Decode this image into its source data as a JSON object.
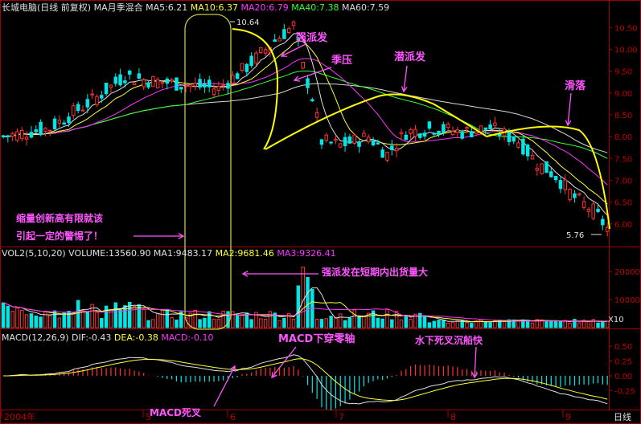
{
  "chart_data": {
    "type": "candlestick",
    "period": "日线",
    "price_panel": {
      "header": [
        {
          "text": "长城电脑(日线 前复权) MA月季混合",
          "color": "#e0e0e0"
        },
        {
          "text": "MA5:6.21",
          "color": "#e0e0e0"
        },
        {
          "text": "MA10:6.37",
          "color": "#ffff33"
        },
        {
          "text": "MA20:6.79",
          "color": "#ff33ff"
        },
        {
          "text": "MA40:7.38",
          "color": "#33ff33"
        },
        {
          "text": "MA60:7.59",
          "color": "#d8d8d8"
        }
      ],
      "y_ticks": [
        "10.50",
        "10.00",
        "9.50",
        "9.00",
        "8.50",
        "8.00",
        "7.50",
        "7.00",
        "6.50",
        "6.00"
      ],
      "ylim": [
        5.5,
        10.8
      ],
      "high_label": "10.64",
      "low_label": "5.76",
      "ma_series": [
        {
          "name": "MA5",
          "color": "#e0e0e0"
        },
        {
          "name": "MA10",
          "color": "#ffff33"
        },
        {
          "name": "MA20",
          "color": "#ff33ff"
        },
        {
          "name": "MA40",
          "color": "#33ff33"
        },
        {
          "name": "MA60",
          "color": "#d8d8d8"
        }
      ]
    },
    "volume_panel": {
      "header": [
        {
          "text": "VOL2(5,10,20) VOLUME:13560.90",
          "color": "#e0e0e0"
        },
        {
          "text": "MA1:9483.17",
          "color": "#e0e0e0"
        },
        {
          "text": "MA2:9681.46",
          "color": "#ffff33"
        },
        {
          "text": "MA3:9326.41",
          "color": "#ff33ff"
        }
      ],
      "y_ticks": [
        "20000",
        "10000"
      ],
      "unit_box": "X10"
    },
    "macd_panel": {
      "header": [
        {
          "text": "MACD(12,26,9)",
          "color": "#e0e0e0"
        },
        {
          "text": "DIF:-0.43",
          "color": "#e0e0e0"
        },
        {
          "text": "DEA:-0.38",
          "color": "#ffff33"
        },
        {
          "text": "MACD:-0.10",
          "color": "#ff33ff"
        }
      ],
      "y_ticks": [
        "0.50",
        "0.25",
        "0.00",
        "-0.25"
      ]
    },
    "x_labels": [
      "2004年",
      "5",
      "6",
      "7",
      "8",
      "9"
    ],
    "x_corner_label": "日线",
    "annotations": {
      "strong_rally": "强派发",
      "seasonal_pressure": "季压",
      "latent_distribution": "潜派发",
      "slide": "滑落",
      "warning_line1": "缩量创新高有限就该",
      "warning_line2": "引起一定的警惕了！",
      "volume_note": "强派发在短期内出货量大",
      "macd_cross_axis": "MACD下穿零轴",
      "underwater_cross": "水下死叉沉船快",
      "macd_death_cross": "MACD死叉"
    }
  }
}
